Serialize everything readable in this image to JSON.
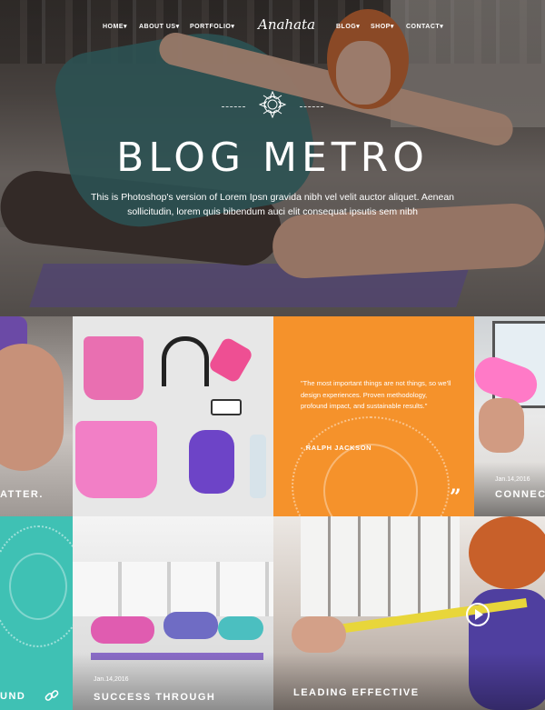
{
  "nav": {
    "logo": "Anahata",
    "items_left": [
      "HOME",
      "ABOUT US",
      "PORTFOLIO"
    ],
    "items_right": [
      "BLOG",
      "SHOP",
      "CONTACT"
    ],
    "caret": "▾"
  },
  "hero": {
    "title": "BLOG METRO",
    "subtitle": "This is Photoshop's version  of Lorem Ipsn gravida nibh vel velit auctor aliquet. Aenean sollicitudin, lorem quis bibendum auci elit consequat ipsutis sem nibh",
    "icon": "mandala-icon"
  },
  "tiles": {
    "left_pose": {
      "caption": "ATTER."
    },
    "quote": {
      "text": "\"The most important things are not things, so we'll design experiences. Proven methodology, profound impact, and sustainable results.\"",
      "author": "- RALPH JACKSON",
      "mark": "”"
    },
    "connect": {
      "date": "Jan.14,2016",
      "caption": "CONNEC"
    },
    "teal": {
      "caption": "UND",
      "icon": "link-icon"
    },
    "success": {
      "date": "Jan.14,2016",
      "caption": "SUCCESS THROUGH"
    },
    "leading": {
      "caption": "LEADING EFFECTIVE",
      "icon": "play-icon"
    }
  },
  "colors": {
    "orange": "#f5922b",
    "teal": "#3fc1b4"
  }
}
